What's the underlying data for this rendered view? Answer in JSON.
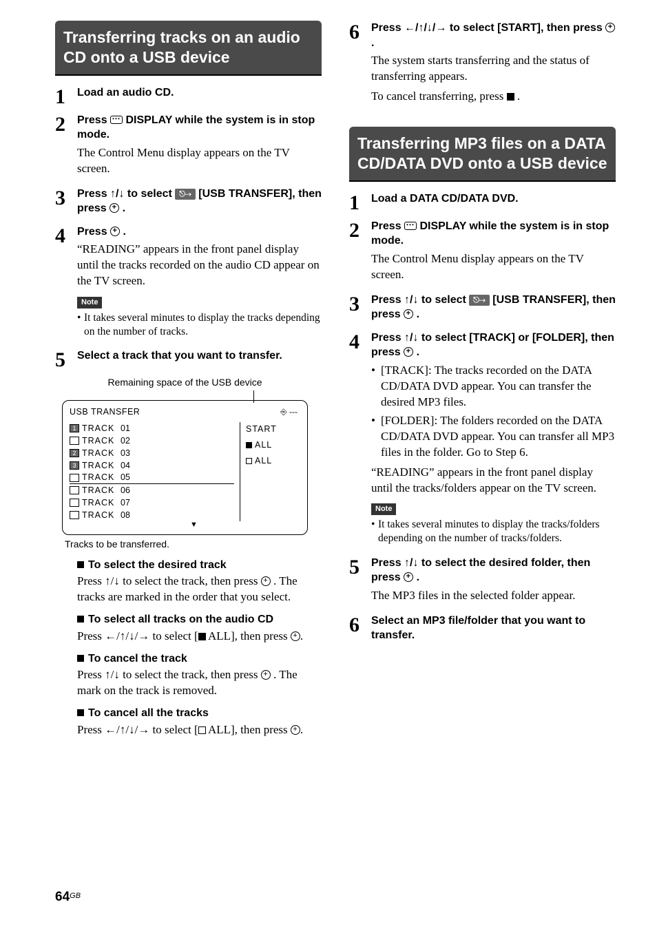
{
  "page": {
    "number": "64",
    "lang": "GB"
  },
  "left": {
    "heading": "Transferring tracks on an audio CD onto a USB device",
    "s1": {
      "head": "Load an audio CD."
    },
    "s2": {
      "head_a": "Press ",
      "head_b": " DISPLAY while the system is in stop mode.",
      "text": "The Control Menu display appears on the TV screen."
    },
    "s3": {
      "head_a": "Press ↑/↓ to select ",
      "badge": "⎋⇢",
      "head_b": " [USB TRANSFER], then press ",
      "head_c": "."
    },
    "s4": {
      "head_a": "Press ",
      "head_b": ".",
      "text": "“READING” appears in the front panel display until the tracks recorded on the audio CD appear on the TV screen.",
      "note_label": "Note",
      "note_item": "It takes several minutes to display the tracks depending on the number of tracks."
    },
    "s5": {
      "head": "Select a track that you want to transfer.",
      "caption_top": "Remaining space of the USB device",
      "panel_title": "USB TRANSFER",
      "panel_remaining": "⎆ ---",
      "tracks": [
        {
          "chk": "1",
          "filled": true,
          "label": "TRACK",
          "num": "01",
          "underline": false
        },
        {
          "chk": "",
          "filled": false,
          "label": "TRACK",
          "num": "02",
          "underline": false
        },
        {
          "chk": "2",
          "filled": true,
          "label": "TRACK",
          "num": "03",
          "underline": false
        },
        {
          "chk": "3",
          "filled": true,
          "label": "TRACK",
          "num": "04",
          "underline": false
        },
        {
          "chk": "",
          "filled": false,
          "label": "TRACK",
          "num": "05",
          "underline": true
        },
        {
          "chk": "",
          "filled": false,
          "label": "TRACK",
          "num": "06",
          "underline": false
        },
        {
          "chk": "",
          "filled": false,
          "label": "TRACK",
          "num": "07",
          "underline": false
        },
        {
          "chk": "",
          "filled": false,
          "label": "TRACK",
          "num": "08",
          "underline": false
        }
      ],
      "side_start": "START",
      "side_all_fill": "ALL",
      "side_all_empty": "ALL",
      "caption_bottom": "Tracks to be transferred.",
      "sub1_head": "To select the desired track",
      "sub1_a": "Press ↑/↓ to select the track, then press ",
      "sub1_b": ". The tracks are marked in the order that you select.",
      "sub2_head": "To select all tracks on the audio CD",
      "sub2_a": "Press ←/↑/↓/→ to select [",
      "sub2_b": " ALL], then press ",
      "sub2_c": ".",
      "sub3_head": "To cancel the track",
      "sub3_a": "Press ↑/↓ to select the track, then press ",
      "sub3_b": ". The mark on the track is removed.",
      "sub4_head": "To cancel all the tracks",
      "sub4_a": "Press ←/↑/↓/→ to select [",
      "sub4_b": " ALL], then press ",
      "sub4_c": "."
    }
  },
  "right": {
    "s6": {
      "head_a": "Press ←/↑/↓/→ to select [START], then press ",
      "head_b": ".",
      "text1": "The system starts transferring and the status of transferring appears.",
      "text2_a": "To cancel transferring, press ",
      "text2_b": "."
    },
    "heading": "Transferring MP3 files on a DATA CD/DATA DVD onto a USB device",
    "r1": {
      "head": "Load a DATA CD/DATA DVD."
    },
    "r2": {
      "head_a": "Press ",
      "head_b": " DISPLAY while the system is in stop mode.",
      "text": "The Control Menu display appears on the TV screen."
    },
    "r3": {
      "head_a": "Press ↑/↓ to select ",
      "badge": "⎋⇢",
      "head_b": " [USB TRANSFER], then press ",
      "head_c": "."
    },
    "r4": {
      "head_a": "Press ↑/↓ to select [TRACK] or [FOLDER], then press ",
      "head_b": ".",
      "bullet1": "[TRACK]: The tracks recorded on the DATA CD/DATA DVD appear. You can transfer the desired MP3 files.",
      "bullet2": "[FOLDER]: The folders recorded on the DATA CD/DATA DVD appear. You can transfer all MP3 files in the folder. Go to Step 6.",
      "text": "“READING” appears in the front panel display until the tracks/folders appear on the TV screen.",
      "note_label": "Note",
      "note_item": "It takes several minutes to display the tracks/folders depending on the number of tracks/folders."
    },
    "r5": {
      "head_a": "Press ↑/↓ to select the desired folder, then press ",
      "head_b": ".",
      "text": "The MP3 files in the selected folder appear."
    },
    "r6": {
      "head": "Select an MP3 file/folder that you want to transfer."
    }
  }
}
